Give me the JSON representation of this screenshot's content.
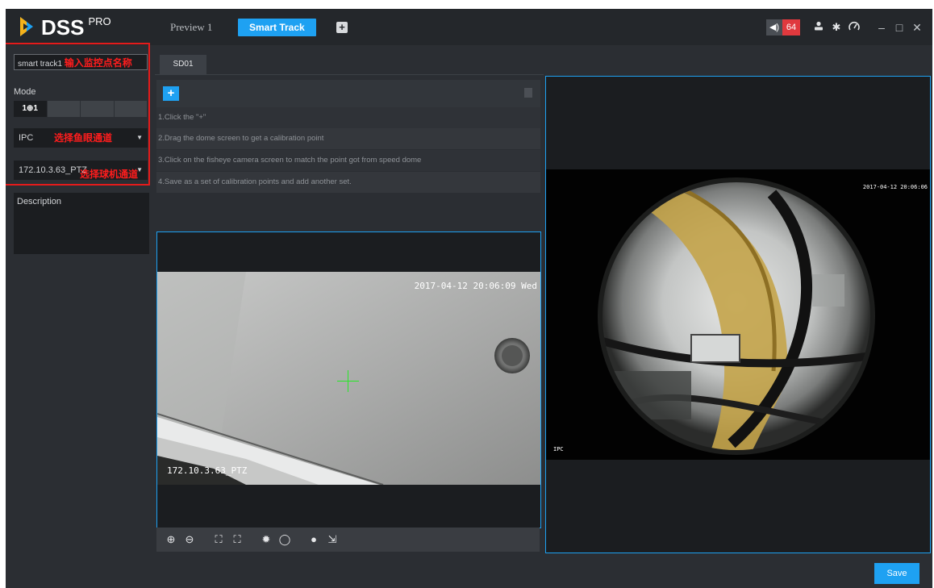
{
  "app": {
    "logo_text": "DSS",
    "logo_sup": "PRO"
  },
  "tabs": [
    {
      "label": "Preview 1"
    },
    {
      "label": "Smart Track",
      "active": true
    }
  ],
  "header": {
    "alarm_count": "64"
  },
  "left": {
    "name_value": "smart track1",
    "name_note": "输入监控点名称",
    "mode_label": "Mode",
    "mode_option": "1⊕1",
    "fisheye_value": "IPC",
    "fisheye_note": "选择鱼眼通道",
    "ptz_value": "172.10.3.63_PTZ",
    "ptz_note": "选择球机通道",
    "description_label": "Description"
  },
  "channel_tab": "SD01",
  "steps": [
    "1.Click the \"+\"",
    "2.Drag the dome screen to get a calibration point",
    "3.Click on the fisheye camera screen to match the point got from speed dome",
    "4.Save as a set of calibration points and add another set."
  ],
  "dome_video": {
    "timestamp": "2017-04-12 20:06:09 Wed",
    "channel_name": "172.10.3.63_PTZ"
  },
  "fisheye_video": {
    "timestamp": "2017-04-12 20:06:06",
    "channel_name": "IPC"
  },
  "footer": {
    "save_label": "Save"
  },
  "colors": {
    "accent": "#1ea1f2",
    "annotation_red": "#ff1d1d",
    "crosshair": "#27e827"
  }
}
